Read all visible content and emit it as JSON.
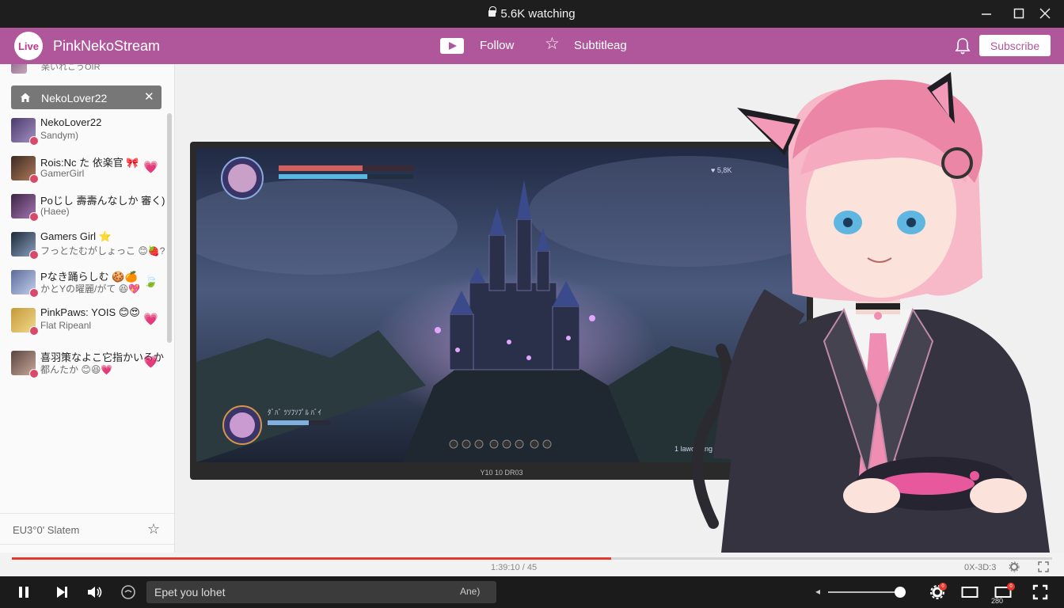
{
  "window": {
    "title": "5.6K watching"
  },
  "header": {
    "live_badge": "Live",
    "channel_name": "PinkNekoStream",
    "follow_label": "Follow",
    "subtitle_label": "Subtitleag",
    "subscribe_label": "Subscribe"
  },
  "sidebar": {
    "top_cut_text": "楽いれこうOIR",
    "search_chip_label": "NekoLover22",
    "messages": [
      {
        "line1": "NekoLover22",
        "line2": "Sandym)",
        "heart": ""
      },
      {
        "line1": "Rois:Nc た 依楽官 🎀",
        "line2": "GamerGirl",
        "heart": "💗"
      },
      {
        "line1": "Poじし 壽壽んなしか 審く)",
        "line2": "(Haee)",
        "heart": ""
      },
      {
        "line1": "Gamers Girl ⭐",
        "line2": "フっとたむがしょっこ 😊🍓?",
        "heart": ""
      },
      {
        "line1": "Pなき踊らしむ 🍪🍊",
        "line2": "かとYの曜麗/がて 😆💖",
        "heart": "🍃"
      },
      {
        "line1": "PinkPaws: YOIS 😊😍",
        "line2": "Flat Ripeanl",
        "heart": "💗"
      },
      {
        "line1": "喜羽策なよこ它指かいるか",
        "line2": "都んたか 😊😆💗",
        "heart": "💗"
      }
    ],
    "footer_label": "EU3°0' Slatem"
  },
  "stage": {
    "game_hud_top": "♥ 5,8K",
    "game_hud_bottom": "ﾀﾞﾊﾞ ﾂｿﾌｿﾌﾟﾙ ﾊﾞｲ",
    "game_hud_right": "1 lawooding",
    "monitor_caption": "Y10 10 DR03"
  },
  "progress": {
    "played_fraction": 0.576,
    "time_center": "1:39:10 / 45",
    "time_right": "0X-3D:3"
  },
  "controls": {
    "chat_placeholder": "Epet you lohet",
    "send_label": "Ane)",
    "volume_fraction": 0.93,
    "badge_one": "0",
    "badge_two": "0",
    "quality_label": "280"
  },
  "colors": {
    "brand": "#b0579b",
    "progress": "#e23a2e",
    "heart": "#e055b7"
  }
}
